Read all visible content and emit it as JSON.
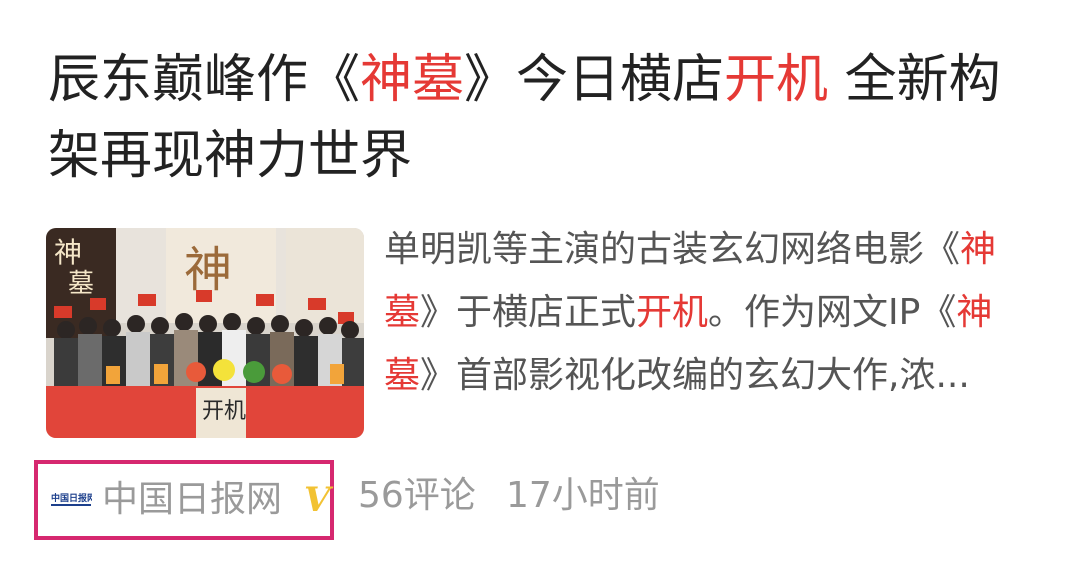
{
  "article": {
    "title_parts": [
      {
        "text": "辰东巅峰作《",
        "highlight": false
      },
      {
        "text": "神墓",
        "highlight": true
      },
      {
        "text": "》今日横店",
        "highlight": false
      },
      {
        "text": "开机",
        "highlight": true
      },
      {
        "text": " 全新构架再现神力世界",
        "highlight": false
      }
    ],
    "summary_parts": [
      {
        "text": "单明凯等主演的古装玄幻网络电影《",
        "highlight": false
      },
      {
        "text": "神墓",
        "highlight": true
      },
      {
        "text": "》于横店正式",
        "highlight": false
      },
      {
        "text": "开机",
        "highlight": true
      },
      {
        "text": "。作为网文IP《",
        "highlight": false
      },
      {
        "text": "神墓",
        "highlight": true
      },
      {
        "text": "》首部影视化改编的玄幻大作,浓...",
        "highlight": false
      }
    ],
    "thumbnail": {
      "alt": "opening ceremony group photo",
      "banner_text_left": "神",
      "banner_text_left2": "墓",
      "banner_text_center": "神",
      "table_text": "开机"
    },
    "source": {
      "name": "中国日报网",
      "verified_mark": "V",
      "logo_icon": "china-daily-logo-icon"
    },
    "comments": "56评论",
    "time": "17小时前"
  },
  "colors": {
    "highlight": "#e53935",
    "title": "#222222",
    "summary": "#555555",
    "meta": "#9a9a9a",
    "verified": "#f2c233",
    "selection_box": "#d6286f"
  }
}
